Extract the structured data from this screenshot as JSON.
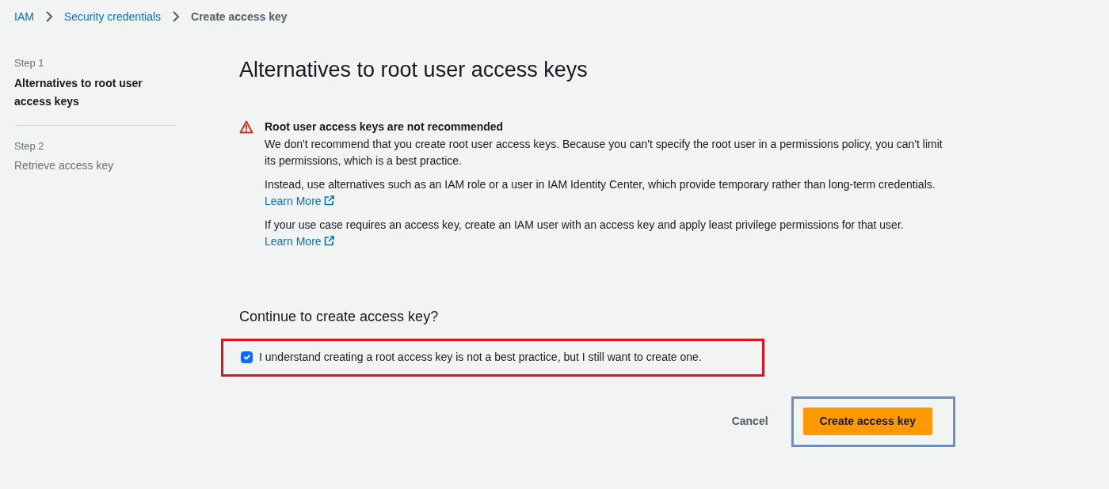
{
  "breadcrumb": [
    {
      "label": "IAM",
      "kind": "link"
    },
    {
      "label": "Security credentials",
      "kind": "link"
    },
    {
      "label": "Create access key",
      "kind": "current"
    }
  ],
  "steps": [
    {
      "step": "Step 1",
      "label": "Alternatives to root user access keys",
      "selected": true
    },
    {
      "step": "Step 2",
      "label": "Retrieve access key",
      "selected": false
    }
  ],
  "title": "Alternatives to root user access keys",
  "alert": {
    "title": "Root user access keys are not recommended",
    "paragraphs": [
      {
        "text": "We don't recommend that you create root user access keys. Because you can't specify the root user in a permissions policy, you can't limit its permissions, which is a best practice."
      },
      {
        "text": "Instead, use alternatives such as an IAM role or a user in IAM Identity Center, which provide temporary rather than long-term credentials.",
        "link": "Learn More"
      },
      {
        "text": "If your use case requires an access key, create an IAM user with an access key and apply least privilege permissions for that user.",
        "link": "Learn More"
      }
    ]
  },
  "confirm": {
    "heading": "Continue to create access key?",
    "label": "I understand creating a root access key is not a best practice, but I still want to create one.",
    "checked": true
  },
  "buttons": [
    {
      "label": "Cancel",
      "kind": "link"
    },
    {
      "label": "Create access key",
      "kind": "primary"
    }
  ]
}
